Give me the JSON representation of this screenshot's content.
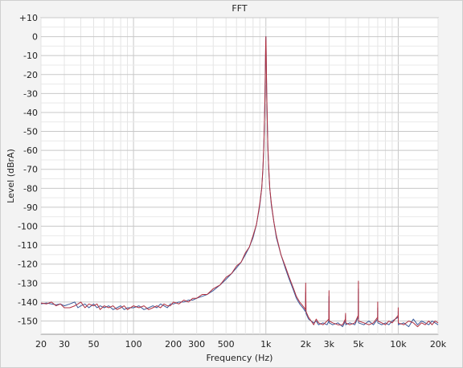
{
  "chart_data": {
    "type": "line",
    "title": "FFT",
    "xlabel": "Frequency (Hz)",
    "ylabel": "Level (dBrA)",
    "x_scale": "log",
    "xlim": [
      20,
      20000
    ],
    "ylim": [
      -157,
      10
    ],
    "grid": true,
    "y_ticks": [
      {
        "v": 10,
        "label": "+10"
      },
      {
        "v": 0,
        "label": "0"
      },
      {
        "v": -10,
        "label": "-10"
      },
      {
        "v": -20,
        "label": "-20"
      },
      {
        "v": -30,
        "label": "-30"
      },
      {
        "v": -40,
        "label": "-40"
      },
      {
        "v": -50,
        "label": "-50"
      },
      {
        "v": -60,
        "label": "-60"
      },
      {
        "v": -70,
        "label": "-70"
      },
      {
        "v": -80,
        "label": "-80"
      },
      {
        "v": -90,
        "label": "-90"
      },
      {
        "v": -100,
        "label": "-100"
      },
      {
        "v": -110,
        "label": "-110"
      },
      {
        "v": -120,
        "label": "-120"
      },
      {
        "v": -130,
        "label": "-130"
      },
      {
        "v": -140,
        "label": "-140"
      },
      {
        "v": -150,
        "label": "-150"
      }
    ],
    "x_ticks": [
      {
        "v": 20,
        "label": "20"
      },
      {
        "v": 30,
        "label": "30"
      },
      {
        "v": 50,
        "label": "50"
      },
      {
        "v": 100,
        "label": "100"
      },
      {
        "v": 200,
        "label": "200"
      },
      {
        "v": 300,
        "label": "300"
      },
      {
        "v": 500,
        "label": "500"
      },
      {
        "v": 1000,
        "label": "1k"
      },
      {
        "v": 2000,
        "label": "2k"
      },
      {
        "v": 3000,
        "label": "3k"
      },
      {
        "v": 5000,
        "label": "5k"
      },
      {
        "v": 10000,
        "label": "10k"
      },
      {
        "v": 20000,
        "label": "20k"
      }
    ],
    "series": [
      {
        "color": "#3a5a9a",
        "points": [
          [
            20,
            -141
          ],
          [
            22,
            -140.5
          ],
          [
            24,
            -141
          ],
          [
            26,
            -141.5
          ],
          [
            28,
            -141
          ],
          [
            30,
            -142
          ],
          [
            33,
            -141
          ],
          [
            36,
            -140
          ],
          [
            38,
            -143
          ],
          [
            40,
            -142
          ],
          [
            43,
            -141
          ],
          [
            46,
            -143
          ],
          [
            50,
            -141
          ],
          [
            53,
            -143
          ],
          [
            56,
            -142
          ],
          [
            60,
            -143
          ],
          [
            65,
            -142
          ],
          [
            70,
            -144
          ],
          [
            75,
            -143
          ],
          [
            80,
            -142
          ],
          [
            85,
            -144
          ],
          [
            90,
            -143
          ],
          [
            100,
            -143
          ],
          [
            110,
            -142
          ],
          [
            120,
            -144
          ],
          [
            130,
            -143
          ],
          [
            140,
            -142
          ],
          [
            150,
            -143
          ],
          [
            160,
            -141
          ],
          [
            170,
            -142
          ],
          [
            180,
            -143
          ],
          [
            190,
            -141
          ],
          [
            200,
            -141
          ],
          [
            220,
            -140
          ],
          [
            240,
            -140
          ],
          [
            260,
            -139
          ],
          [
            280,
            -139
          ],
          [
            300,
            -138
          ],
          [
            330,
            -137
          ],
          [
            360,
            -136
          ],
          [
            400,
            -134
          ],
          [
            450,
            -131
          ],
          [
            500,
            -128
          ],
          [
            550,
            -125
          ],
          [
            600,
            -122
          ],
          [
            650,
            -119
          ],
          [
            700,
            -115
          ],
          [
            750,
            -111
          ],
          [
            800,
            -106
          ],
          [
            850,
            -99
          ],
          [
            900,
            -89
          ],
          [
            930,
            -80
          ],
          [
            950,
            -70
          ],
          [
            965,
            -58
          ],
          [
            975,
            -45
          ],
          [
            985,
            -30
          ],
          [
            992,
            -15
          ],
          [
            997,
            -5
          ],
          [
            1000,
            0
          ],
          [
            1003,
            -5
          ],
          [
            1008,
            -15
          ],
          [
            1015,
            -30
          ],
          [
            1025,
            -45
          ],
          [
            1035,
            -58
          ],
          [
            1050,
            -70
          ],
          [
            1070,
            -80
          ],
          [
            1100,
            -89
          ],
          [
            1150,
            -98
          ],
          [
            1200,
            -106
          ],
          [
            1300,
            -115
          ],
          [
            1400,
            -122
          ],
          [
            1500,
            -128
          ],
          [
            1600,
            -133
          ],
          [
            1700,
            -138
          ],
          [
            1800,
            -141
          ],
          [
            1900,
            -143
          ],
          [
            1990,
            -145
          ],
          [
            2000,
            -135
          ],
          [
            2010,
            -146
          ],
          [
            2100,
            -149
          ],
          [
            2200,
            -150
          ],
          [
            2300,
            -151
          ],
          [
            2400,
            -150
          ],
          [
            2500,
            -152
          ],
          [
            2700,
            -151
          ],
          [
            2900,
            -152
          ],
          [
            2990,
            -150
          ],
          [
            3000,
            -137
          ],
          [
            3010,
            -151
          ],
          [
            3200,
            -152
          ],
          [
            3500,
            -151
          ],
          [
            3800,
            -153
          ],
          [
            3990,
            -150
          ],
          [
            4000,
            -147
          ],
          [
            4010,
            -152
          ],
          [
            4300,
            -151
          ],
          [
            4700,
            -152
          ],
          [
            4990,
            -148
          ],
          [
            5000,
            -133
          ],
          [
            5010,
            -151
          ],
          [
            5500,
            -152
          ],
          [
            6000,
            -150
          ],
          [
            6500,
            -152
          ],
          [
            6990,
            -149
          ],
          [
            7000,
            -143
          ],
          [
            7010,
            -151
          ],
          [
            7500,
            -152
          ],
          [
            8000,
            -151
          ],
          [
            8500,
            -152
          ],
          [
            9000,
            -150
          ],
          [
            9990,
            -148
          ],
          [
            10000,
            -145
          ],
          [
            10010,
            -152
          ],
          [
            11000,
            -151
          ],
          [
            12000,
            -153
          ],
          [
            13000,
            -149
          ],
          [
            14000,
            -152
          ],
          [
            15000,
            -150
          ],
          [
            16000,
            -151
          ],
          [
            17000,
            -152
          ],
          [
            18000,
            -150
          ],
          [
            19000,
            -151
          ],
          [
            20000,
            -152
          ]
        ]
      },
      {
        "color": "#b03040",
        "points": [
          [
            20,
            -140.5
          ],
          [
            22,
            -141
          ],
          [
            24,
            -140
          ],
          [
            26,
            -142
          ],
          [
            28,
            -141
          ],
          [
            30,
            -143
          ],
          [
            33,
            -143
          ],
          [
            36,
            -142
          ],
          [
            38,
            -141
          ],
          [
            40,
            -140
          ],
          [
            43,
            -143
          ],
          [
            46,
            -141
          ],
          [
            50,
            -142
          ],
          [
            53,
            -141
          ],
          [
            56,
            -144
          ],
          [
            60,
            -142
          ],
          [
            65,
            -143
          ],
          [
            70,
            -142
          ],
          [
            75,
            -144
          ],
          [
            80,
            -143
          ],
          [
            85,
            -142
          ],
          [
            90,
            -144
          ],
          [
            100,
            -142
          ],
          [
            110,
            -143
          ],
          [
            120,
            -142
          ],
          [
            130,
            -144
          ],
          [
            140,
            -143
          ],
          [
            150,
            -142
          ],
          [
            160,
            -143
          ],
          [
            170,
            -141
          ],
          [
            180,
            -142
          ],
          [
            190,
            -142
          ],
          [
            200,
            -140
          ],
          [
            220,
            -141
          ],
          [
            240,
            -139
          ],
          [
            260,
            -140
          ],
          [
            280,
            -138
          ],
          [
            300,
            -138
          ],
          [
            330,
            -136
          ],
          [
            360,
            -136
          ],
          [
            400,
            -133
          ],
          [
            450,
            -131
          ],
          [
            500,
            -127
          ],
          [
            550,
            -125
          ],
          [
            600,
            -121
          ],
          [
            650,
            -119
          ],
          [
            700,
            -114
          ],
          [
            750,
            -111
          ],
          [
            800,
            -105
          ],
          [
            850,
            -99
          ],
          [
            900,
            -88
          ],
          [
            930,
            -80
          ],
          [
            950,
            -69
          ],
          [
            965,
            -58
          ],
          [
            975,
            -44
          ],
          [
            985,
            -30
          ],
          [
            992,
            -14
          ],
          [
            997,
            -4
          ],
          [
            1000,
            0
          ],
          [
            1003,
            -4
          ],
          [
            1008,
            -14
          ],
          [
            1015,
            -30
          ],
          [
            1025,
            -44
          ],
          [
            1035,
            -58
          ],
          [
            1050,
            -69
          ],
          [
            1070,
            -80
          ],
          [
            1100,
            -88
          ],
          [
            1150,
            -98
          ],
          [
            1200,
            -105
          ],
          [
            1300,
            -115
          ],
          [
            1400,
            -121
          ],
          [
            1500,
            -127
          ],
          [
            1600,
            -132
          ],
          [
            1700,
            -137
          ],
          [
            1800,
            -140
          ],
          [
            1900,
            -142
          ],
          [
            1990,
            -144
          ],
          [
            2000,
            -130
          ],
          [
            2010,
            -145
          ],
          [
            2100,
            -148
          ],
          [
            2200,
            -150
          ],
          [
            2300,
            -152
          ],
          [
            2400,
            -149
          ],
          [
            2500,
            -151
          ],
          [
            2700,
            -152
          ],
          [
            2900,
            -150
          ],
          [
            2990,
            -149
          ],
          [
            3000,
            -134
          ],
          [
            3010,
            -150
          ],
          [
            3200,
            -151
          ],
          [
            3500,
            -152
          ],
          [
            3800,
            -152
          ],
          [
            3990,
            -149
          ],
          [
            4000,
            -146
          ],
          [
            4010,
            -151
          ],
          [
            4300,
            -152
          ],
          [
            4700,
            -151
          ],
          [
            4990,
            -147
          ],
          [
            5000,
            -129
          ],
          [
            5010,
            -150
          ],
          [
            5500,
            -151
          ],
          [
            6000,
            -152
          ],
          [
            6500,
            -151
          ],
          [
            6990,
            -148
          ],
          [
            7000,
            -140
          ],
          [
            7010,
            -150
          ],
          [
            7500,
            -151
          ],
          [
            8000,
            -152
          ],
          [
            8500,
            -150
          ],
          [
            9000,
            -151
          ],
          [
            9990,
            -147
          ],
          [
            10000,
            -143
          ],
          [
            10010,
            -151
          ],
          [
            11000,
            -152
          ],
          [
            12000,
            -150
          ],
          [
            13000,
            -151
          ],
          [
            14000,
            -153
          ],
          [
            15000,
            -151
          ],
          [
            16000,
            -152
          ],
          [
            17000,
            -150
          ],
          [
            18000,
            -152
          ],
          [
            19000,
            -150
          ],
          [
            20000,
            -151
          ]
        ]
      }
    ]
  }
}
